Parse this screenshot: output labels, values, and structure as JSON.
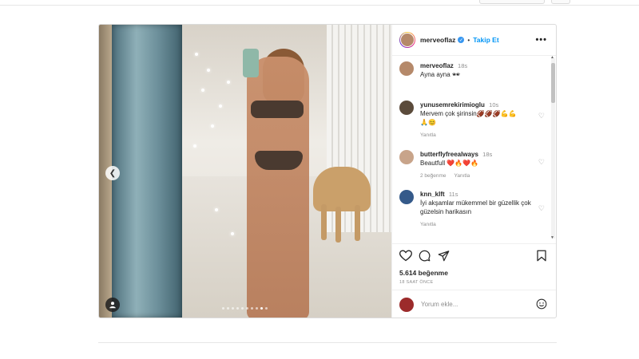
{
  "post": {
    "username": "merveoflaz",
    "follow_label": "Takip Et",
    "separator": "•",
    "more_label": "•••",
    "caption": {
      "username": "merveoflaz",
      "time": "18s",
      "text": "Ayna ayna 🕶"
    },
    "carousel": {
      "total": 10,
      "active": 9
    },
    "comments": [
      {
        "username": "yunusemrekirimioglu",
        "time": "10s",
        "text": "Mervem çok şirinsin🏈🏈🏈💪💪\n🙏😊",
        "meta": [
          "Yanıtla"
        ]
      },
      {
        "username": "butterflyfreealways",
        "time": "18s",
        "text": "Beautfull ❤️🔥❤️🔥",
        "meta": [
          "2 beğenme",
          "Yanıtla"
        ]
      },
      {
        "username": "knn_klft",
        "time": "11s",
        "text": "İyi akşamlar mükemmel bir güzellik çok güzelsin harikasın",
        "meta": [
          "Yanıtla"
        ]
      }
    ],
    "likes": "5.614 beğenme",
    "time_ago": "18 SAAT ÖNCE",
    "comment_placeholder": "Yorum ekle..."
  },
  "colors": {
    "accent": "#0095f6",
    "verified": "#3897f0",
    "muted": "#8e8e8e",
    "border": "#dbdbdb"
  },
  "icons": [
    "chevron-left-icon",
    "user-tag-icon",
    "more-icon",
    "heart-icon",
    "comment-icon",
    "share-icon",
    "bookmark-icon",
    "emoji-icon",
    "verified-icon"
  ]
}
